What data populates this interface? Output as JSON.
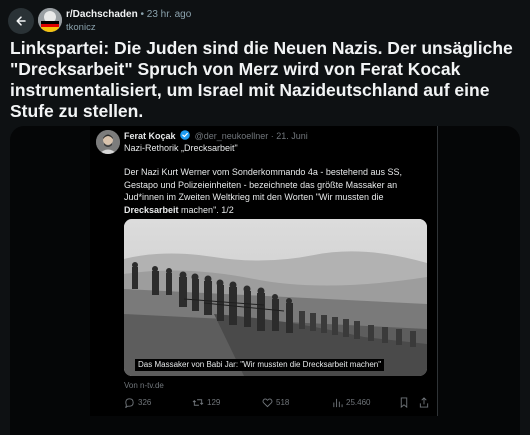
{
  "post": {
    "subreddit": "r/Dachschaden",
    "separator": "•",
    "time": "23 hr. ago",
    "author": "tkonicz",
    "title": "Linkspartei: Die Juden sind die Neuen Nazis. Der unsägliche \"Drecksarbeit\" Spruch von Merz wird von Ferat Kocak instrumentalisiert, um Israel mit Nazideutschland auf eine Stufe zu stellen."
  },
  "tweet": {
    "name": "Ferat Koçak",
    "handle": "@der_neukoellner",
    "separator": "·",
    "date": "21. Juni",
    "subtitle": "Nazi-Rethorik „Drecksarbeit\"",
    "body_part1": "Der Nazi Kurt Werner vom Sonderkommando 4a  - bestehend aus SS, Gestapo und Polizeieinheiten - bezeichnete das größte Massaker an Jud*innen im Zweiten Weltkrieg mit den Worten \"Wir mussten die ",
    "body_bold": "Drecksarbeit",
    "body_part2": " machen\". 1/2",
    "image_caption": "Das Massaker von Babi Jar: \"Wir mussten die Drecksarbeit machen\"",
    "source": "Von n-tv.de",
    "replies": "326",
    "reposts": "129",
    "likes": "518",
    "views": "25.460"
  },
  "colors": {
    "background": "#0e1113",
    "tweet_background": "#000000",
    "muted": "#71767b",
    "verified": "#1d9bf0"
  },
  "icons": [
    "back-arrow-icon",
    "verified-badge-icon",
    "reply-icon",
    "repost-icon",
    "like-icon",
    "views-icon",
    "bookmark-icon",
    "share-icon"
  ]
}
